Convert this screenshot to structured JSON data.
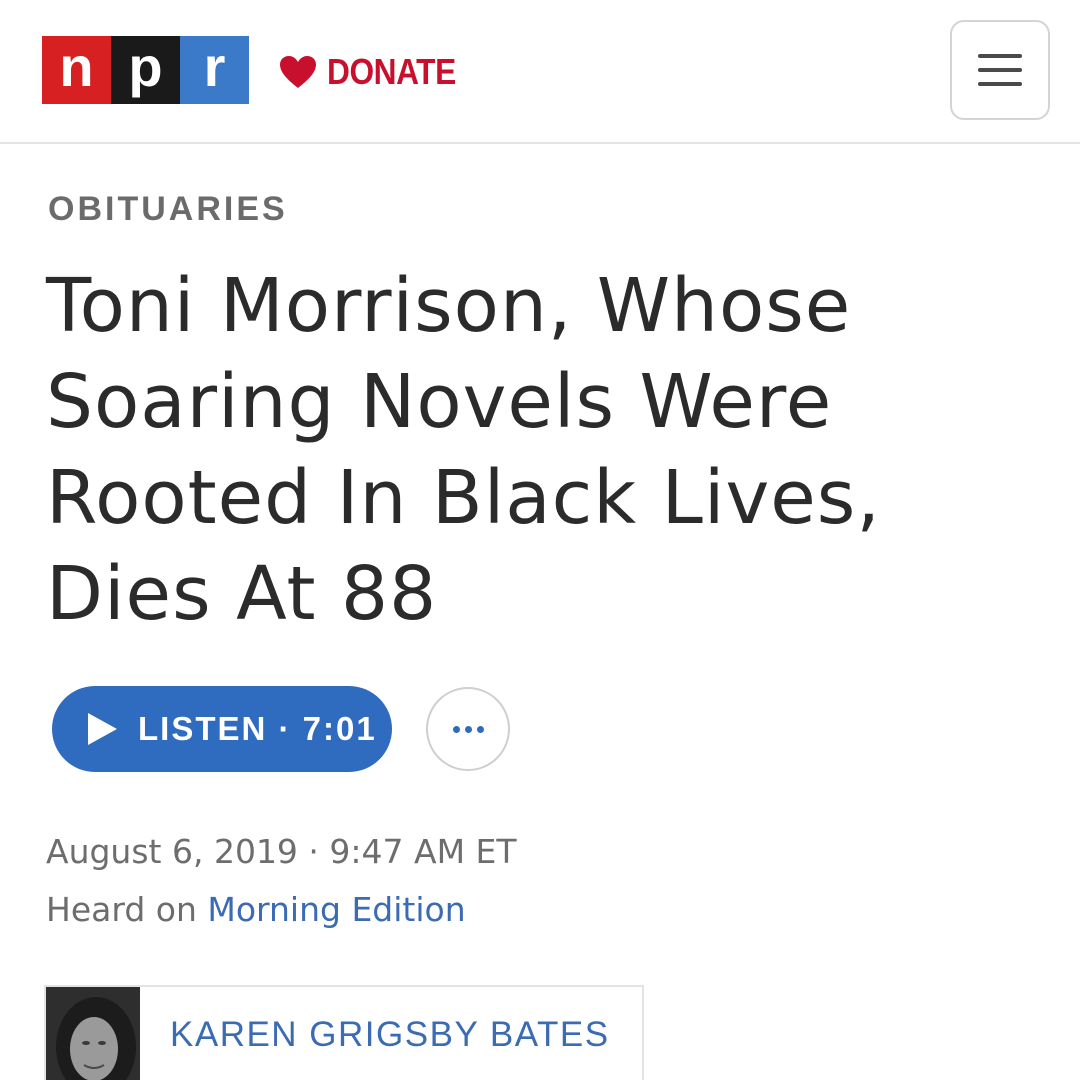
{
  "header": {
    "logo": {
      "letters": [
        "n",
        "p",
        "r"
      ],
      "colors": [
        "#d62021",
        "#1a1a1a",
        "#3b7ac9"
      ]
    },
    "donate": {
      "label": "DONATE",
      "icon": "heart-icon",
      "color": "#c8102e"
    },
    "menu": {
      "icon": "hamburger-menu-icon"
    }
  },
  "article": {
    "section": "OBITUARIES",
    "headline_lines": [
      "Toni Morrison, Whose",
      "Soaring Novels Were",
      "Rooted In Black Lives,",
      "Dies At 88"
    ],
    "listen": {
      "label": "LISTEN · 7:01",
      "icon": "play-icon",
      "color": "#2f6bbe"
    },
    "more": {
      "icon": "more-dots-icon"
    },
    "dateline": "August 6, 2019 · 9:47 AM ET",
    "heard_on": {
      "prefix": "Heard on ",
      "program": "Morning Edition",
      "link_color": "#3b6bb3"
    },
    "byline": {
      "author": "KAREN GRIGSBY BATES",
      "photo": "author-photo"
    }
  }
}
